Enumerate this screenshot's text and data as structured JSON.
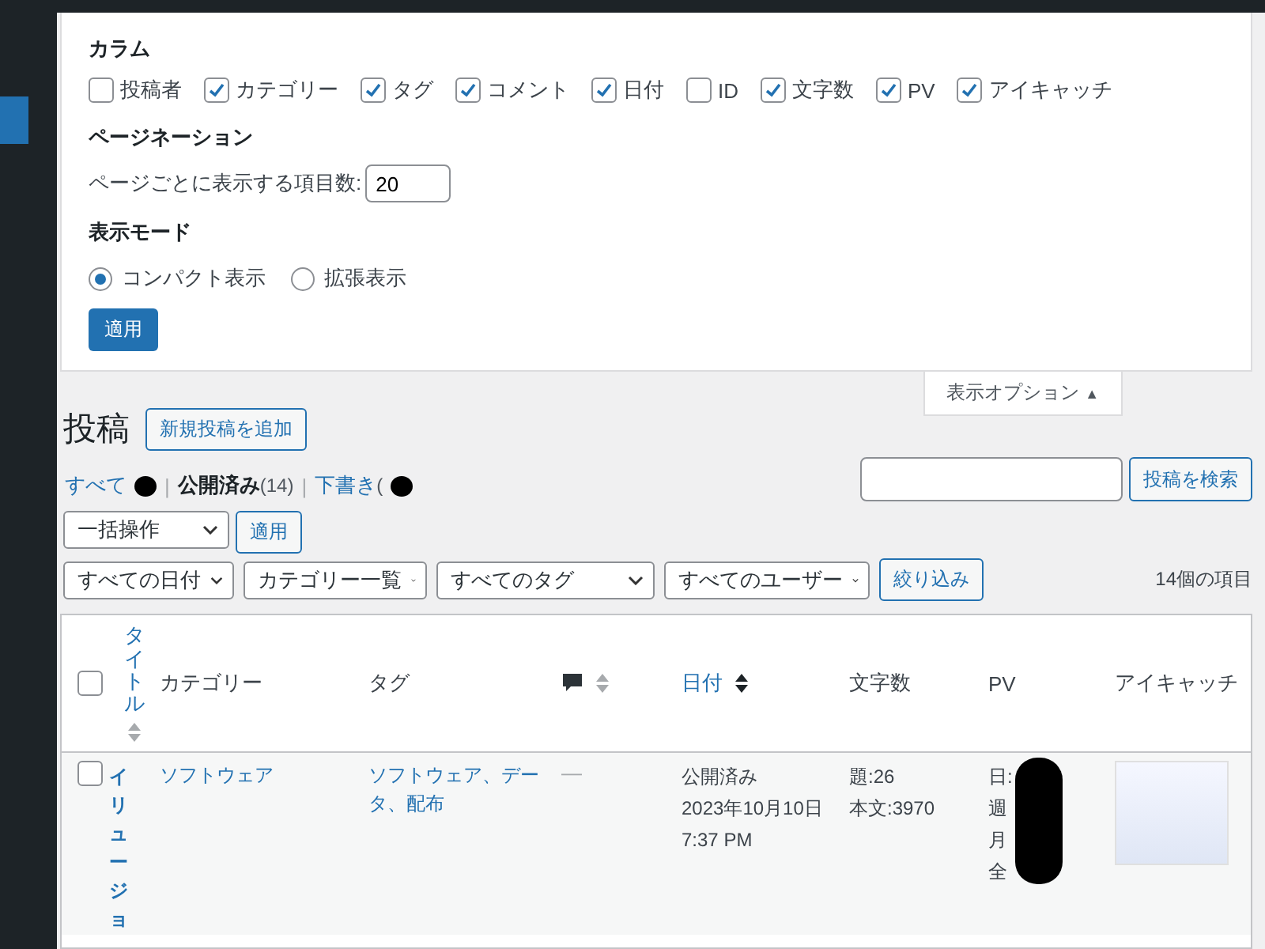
{
  "screen_options": {
    "columns_heading": "カラム",
    "columns": [
      {
        "label": "投稿者",
        "checked": false
      },
      {
        "label": "カテゴリー",
        "checked": true
      },
      {
        "label": "タグ",
        "checked": true
      },
      {
        "label": "コメント",
        "checked": true
      },
      {
        "label": "日付",
        "checked": true
      },
      {
        "label": "ID",
        "checked": false
      },
      {
        "label": "文字数",
        "checked": true
      },
      {
        "label": "PV",
        "checked": true
      },
      {
        "label": "アイキャッチ",
        "checked": true
      }
    ],
    "pagination_heading": "ページネーション",
    "per_page_label": "ページごとに表示する項目数:",
    "per_page_value": "20",
    "view_mode_heading": "表示モード",
    "view_modes": [
      {
        "label": "コンパクト表示",
        "selected": true
      },
      {
        "label": "拡張表示",
        "selected": false
      }
    ],
    "apply_button": "適用",
    "toggle_label": "表示オプション",
    "toggle_arrow": "▲"
  },
  "page_title": "投稿",
  "add_new_button": "新規投稿を追加",
  "status_links": [
    {
      "label": "すべて",
      "redacted": true,
      "selected": false
    },
    {
      "prefix": "|",
      "label": "公開済み",
      "count": "(14)",
      "redacted": false,
      "selected": true
    },
    {
      "prefix": "|",
      "label": "下書き",
      "count": "(",
      "redacted": true,
      "selected": false
    }
  ],
  "search": {
    "button": "投稿を検索"
  },
  "bulk_actions": {
    "select": "一括操作",
    "button": "適用"
  },
  "filters": {
    "selects": [
      "すべての日付",
      "カテゴリー一覧",
      "すべてのタグ",
      "すべてのユーザー"
    ],
    "button": "絞り込み"
  },
  "item_count": "14個の項目",
  "table": {
    "select_all_checked": false,
    "columns": [
      {
        "kind": "check"
      },
      {
        "kind": "title",
        "label": "タイトル"
      },
      {
        "kind": "plain",
        "label": "カテゴリー"
      },
      {
        "kind": "plain",
        "label": "タグ"
      },
      {
        "kind": "comments"
      },
      {
        "kind": "sorted",
        "label": "日付"
      },
      {
        "kind": "plain",
        "label": "文字数"
      },
      {
        "kind": "plain",
        "label": "PV"
      },
      {
        "kind": "plain",
        "label": "アイキャッチ"
      }
    ],
    "rows": [
      {
        "checked": false,
        "title": "イリュージョ",
        "category": "ソフトウェア",
        "tags": "ソフトウェア、データ、配布",
        "comments": "—",
        "date": [
          "公開済み",
          "2023年10月10日",
          "7:37 PM"
        ],
        "chars": [
          "題:26",
          "本文:3970"
        ],
        "pv": [
          "日:",
          "週",
          "月",
          "全"
        ],
        "pv_redacted": true
      }
    ]
  }
}
